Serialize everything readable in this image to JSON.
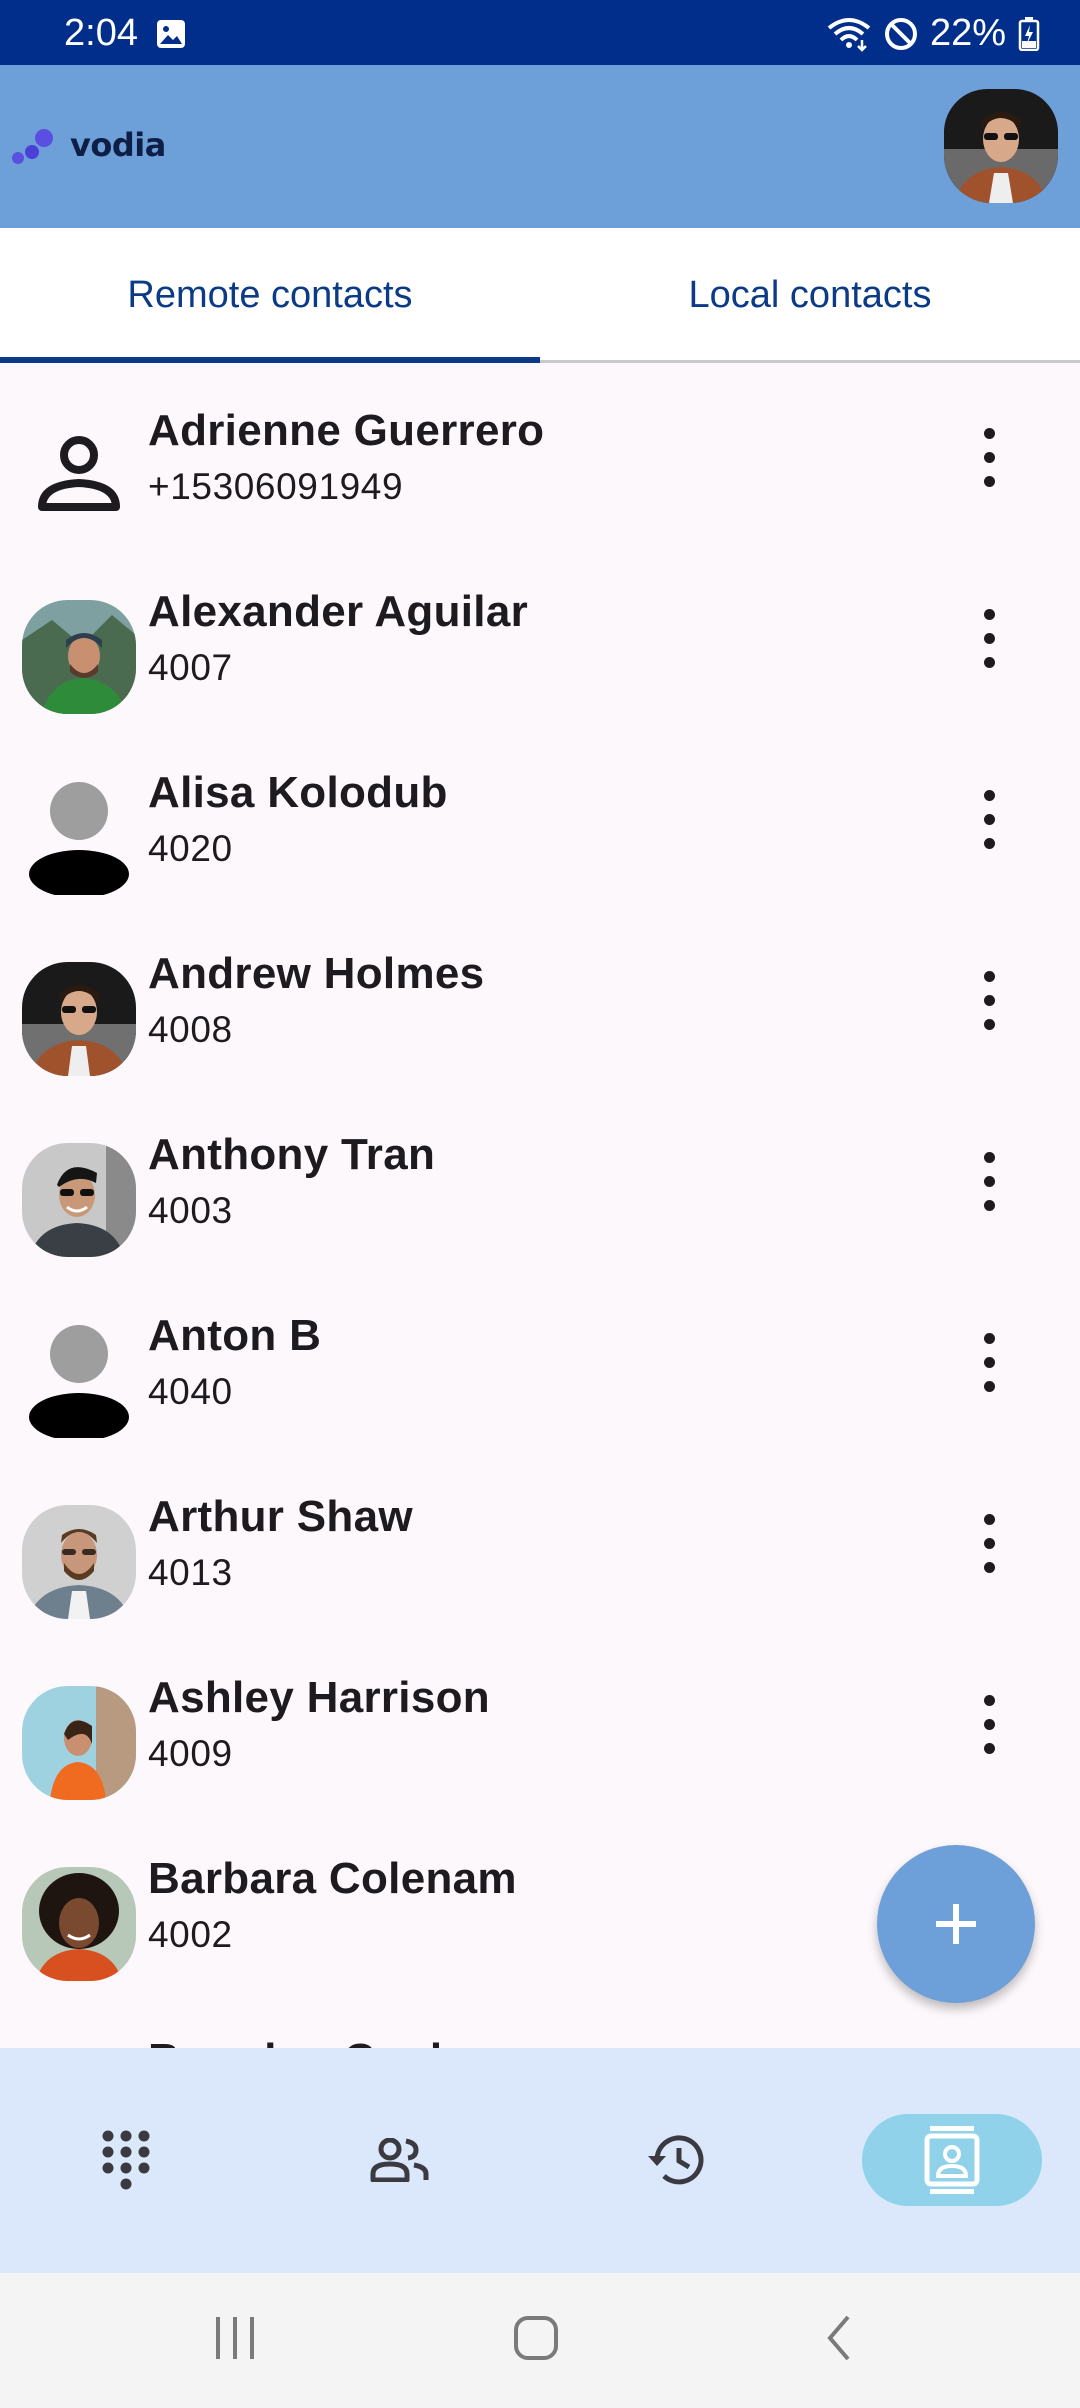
{
  "status_bar": {
    "time": "2:04",
    "battery": "22%"
  },
  "app": {
    "logo_text": "vodia"
  },
  "tabs": [
    {
      "label": "Remote contacts",
      "active": true
    },
    {
      "label": "Local contacts",
      "active": false
    }
  ],
  "contacts": [
    {
      "name": "Adrienne Guerrero",
      "number": "+15306091949",
      "avatar": "outline-person-icon"
    },
    {
      "name": "Alexander Aguilar",
      "number": "4007",
      "avatar": "photo"
    },
    {
      "name": "Alisa Kolodub",
      "number": "4020",
      "avatar": "default-person-icon"
    },
    {
      "name": "Andrew Holmes",
      "number": "4008",
      "avatar": "photo"
    },
    {
      "name": "Anthony Tran",
      "number": "4003",
      "avatar": "photo"
    },
    {
      "name": "Anton B",
      "number": "4040",
      "avatar": "default-person-icon"
    },
    {
      "name": "Arthur Shaw",
      "number": "4013",
      "avatar": "photo"
    },
    {
      "name": "Ashley Harrison",
      "number": "4009",
      "avatar": "photo"
    },
    {
      "name": "Barbara Colenam",
      "number": "4002",
      "avatar": "photo"
    },
    {
      "name": "Brandon Cook",
      "number": "",
      "avatar": "photo"
    }
  ],
  "bottom_nav": [
    {
      "icon": "dialpad-icon",
      "active": false
    },
    {
      "icon": "people-icon",
      "active": false
    },
    {
      "icon": "history-icon",
      "active": false
    },
    {
      "icon": "contacts-icon",
      "active": true
    }
  ],
  "colors": {
    "status_bar": "#002e8a",
    "app_bar": "#6d9fd9",
    "tab_text": "#0b3a86",
    "fab": "#6d9fd9",
    "bottom_nav": "#dbe8fb",
    "active_nav": "#8fd2ea"
  }
}
